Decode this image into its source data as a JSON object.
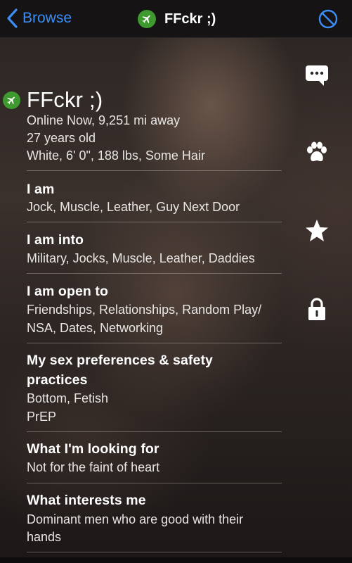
{
  "nav": {
    "back_label": "Browse",
    "title": "FFckr ;)"
  },
  "profile": {
    "name": "FFckr ;)",
    "status": "Online Now, 9,251 mi away",
    "age": "27 years old",
    "stats": "White, 6' 0\", 188 lbs, Some Hair"
  },
  "sections": [
    {
      "title": "I am",
      "lines": [
        "Jock, Muscle, Leather, Guy Next Door"
      ]
    },
    {
      "title": "I am into",
      "lines": [
        "Military, Jocks, Muscle, Leather, Daddies"
      ]
    },
    {
      "title": "I am open to",
      "lines": [
        "Friendships, Relationships, Random Play/",
        "NSA, Dates, Networking"
      ]
    },
    {
      "title_lines": [
        "My sex preferences & safety",
        "practices"
      ],
      "lines": [
        "Bottom, Fetish",
        "PrEP"
      ]
    },
    {
      "title": "What I'm looking for",
      "lines": [
        "Not for the faint of heart"
      ]
    },
    {
      "title": "What interests me",
      "lines": [
        "Dominant men who are good with their",
        "hands"
      ]
    }
  ],
  "actions": {
    "chat": "chat-bubble-icon",
    "woof": "paw-icon",
    "favorite": "star-icon",
    "private": "lock-icon"
  },
  "colors": {
    "accent": "#3a8ef6",
    "badge": "#3e9a2e",
    "navbar": "#151314"
  }
}
